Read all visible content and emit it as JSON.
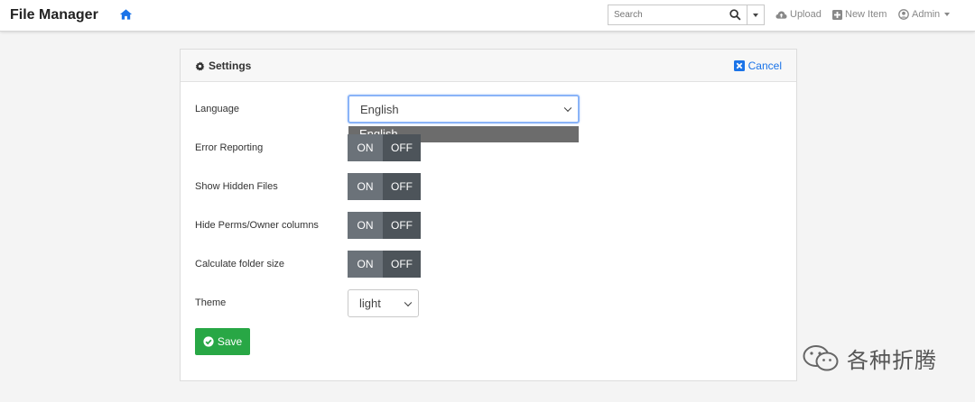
{
  "navbar": {
    "brand": "File Manager",
    "search_placeholder": "Search",
    "upload_label": "Upload",
    "new_item_label": "New Item",
    "user_label": "Admin"
  },
  "settings": {
    "title": "Settings",
    "cancel_label": "Cancel",
    "language": {
      "label": "Language",
      "selected": "English",
      "options": [
        "English"
      ]
    },
    "error_reporting": {
      "label": "Error Reporting",
      "on": "ON",
      "off": "OFF",
      "value": "off"
    },
    "show_hidden": {
      "label": "Show Hidden Files",
      "on": "ON",
      "off": "OFF",
      "value": "off"
    },
    "hide_perms": {
      "label": "Hide Perms/Owner columns",
      "on": "ON",
      "off": "OFF",
      "value": "off"
    },
    "calc_folder": {
      "label": "Calculate folder size",
      "on": "ON",
      "off": "OFF",
      "value": "off"
    },
    "theme": {
      "label": "Theme",
      "selected": "light"
    },
    "save_label": "Save"
  },
  "watermark": {
    "text": "各种折腾"
  },
  "colors": {
    "accent": "#1a73e8",
    "save": "#28a745",
    "toggle_on": "#6b7279",
    "toggle_off": "#4d545a"
  }
}
